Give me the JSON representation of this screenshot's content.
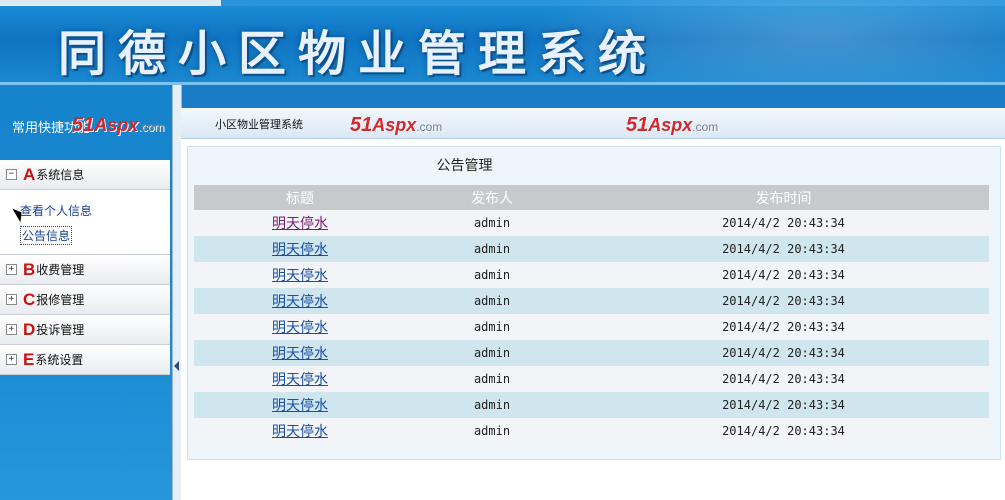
{
  "header": {
    "title": "同德小区物业管理系统"
  },
  "left": {
    "title": "常用快捷功能",
    "groups": [
      {
        "letter": "A",
        "label": "系统信息",
        "toggle": "−",
        "expanded": true,
        "items": [
          {
            "label": "查看个人信息"
          },
          {
            "label": "公告信息"
          }
        ]
      },
      {
        "letter": "B",
        "label": "收费管理",
        "toggle": "+"
      },
      {
        "letter": "C",
        "label": "报修管理",
        "toggle": "+"
      },
      {
        "letter": "D",
        "label": "投诉管理",
        "toggle": "+"
      },
      {
        "letter": "E",
        "label": "系统设置",
        "toggle": "+"
      }
    ]
  },
  "main": {
    "breadcrumb": "小区物业管理系统",
    "page_title": "公告管理",
    "columns": [
      "标题",
      "发布人",
      "发布时间"
    ],
    "rows": [
      {
        "title": "明天停水",
        "publisher": "admin",
        "time": "2014/4/2 20:43:34"
      },
      {
        "title": "明天停水",
        "publisher": "admin",
        "time": "2014/4/2 20:43:34"
      },
      {
        "title": "明天停水",
        "publisher": "admin",
        "time": "2014/4/2 20:43:34"
      },
      {
        "title": "明天停水",
        "publisher": "admin",
        "time": "2014/4/2 20:43:34"
      },
      {
        "title": "明天停水",
        "publisher": "admin",
        "time": "2014/4/2 20:43:34"
      },
      {
        "title": "明天停水",
        "publisher": "admin",
        "time": "2014/4/2 20:43:34"
      },
      {
        "title": "明天停水",
        "publisher": "admin",
        "time": "2014/4/2 20:43:34"
      },
      {
        "title": "明天停水",
        "publisher": "admin",
        "time": "2014/4/2 20:43:34"
      },
      {
        "title": "明天停水",
        "publisher": "admin",
        "time": "2014/4/2 20:43:34"
      }
    ]
  },
  "watermark": {
    "brand_num": "51",
    "brand_asp": "Aspx",
    "brand_com": ".com"
  },
  "colors": {
    "header_blue": "#0f74c2",
    "letter_red": "#cc1111",
    "row_alt": "#cfe6ee",
    "link": "#1a4fa3"
  }
}
